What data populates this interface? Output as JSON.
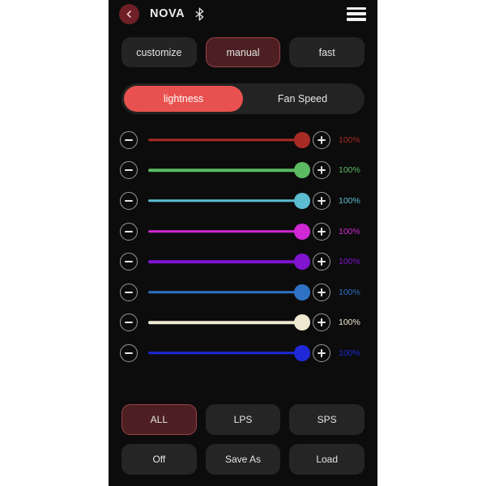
{
  "app": {
    "title": "NOVA",
    "background_color": "#0c0c0c",
    "accent_color": "#e8514f",
    "selected_fill": "#4d1f22",
    "selected_border": "#9a4048"
  },
  "topbar": {
    "back_label": "back",
    "back_icon": "chevron-left-icon",
    "title": "NOVA",
    "bluetooth_icon": "bluetooth-icon",
    "menu_icon": "hamburger-menu-icon"
  },
  "modes": [
    {
      "label": "customize",
      "active": false
    },
    {
      "label": "manual",
      "active": true
    },
    {
      "label": "fast",
      "active": false
    }
  ],
  "segmented": [
    {
      "label": "lightness",
      "active": true
    },
    {
      "label": "Fan Speed",
      "active": false
    }
  ],
  "sliders": [
    {
      "name": "channel-1",
      "color": "#a82b24",
      "thumb": "#a82b24",
      "value": "100%",
      "fill_pct": 100
    },
    {
      "name": "channel-2",
      "color": "#5bba62",
      "thumb": "#5bba62",
      "value": "100%",
      "fill_pct": 100
    },
    {
      "name": "channel-3",
      "color": "#5cbdd1",
      "thumb": "#5cbdd1",
      "value": "100%",
      "fill_pct": 100
    },
    {
      "name": "channel-4",
      "color": "#cf28d4",
      "thumb": "#cf28d4",
      "value": "100%",
      "fill_pct": 100
    },
    {
      "name": "channel-5",
      "color": "#7f15cf",
      "thumb": "#7f15cf",
      "value": "100%",
      "fill_pct": 100
    },
    {
      "name": "channel-6",
      "color": "#2f72c4",
      "thumb": "#2f72c4",
      "value": "100%",
      "fill_pct": 100
    },
    {
      "name": "channel-7",
      "color": "#efe9d2",
      "thumb": "#efe9d2",
      "value": "100%",
      "fill_pct": 100
    },
    {
      "name": "channel-8",
      "color": "#1f29d8",
      "thumb": "#1f29d8",
      "value": "100%",
      "fill_pct": 100
    }
  ],
  "slider_controls": {
    "decrement_label": "decrease",
    "increment_label": "increase"
  },
  "actions_row_1": [
    {
      "label": "ALL",
      "active": true
    },
    {
      "label": "LPS",
      "active": false
    },
    {
      "label": "SPS",
      "active": false
    }
  ],
  "actions_row_2": [
    {
      "label": "Off",
      "active": false
    },
    {
      "label": "Save As",
      "active": false
    },
    {
      "label": "Load",
      "active": false
    }
  ]
}
